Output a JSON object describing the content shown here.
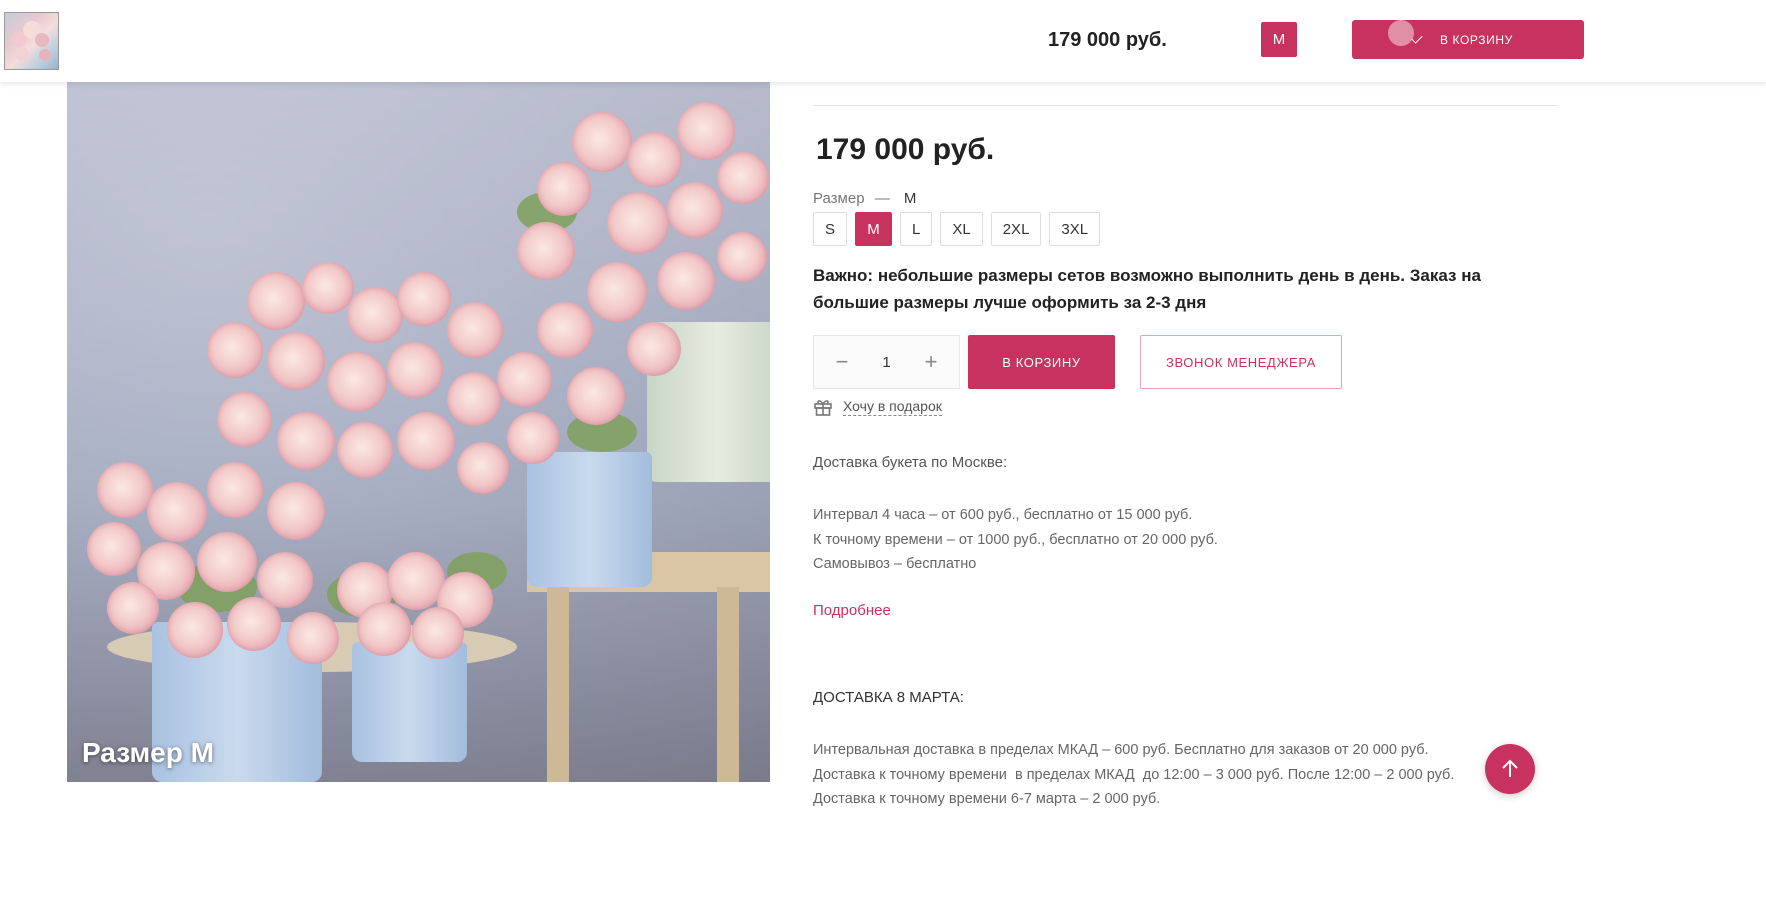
{
  "header": {
    "thumbnail_alt": "bouquet-thumbnail",
    "price": "179 000 руб.",
    "size": "M",
    "cart_label": "В КОРЗИНУ"
  },
  "product": {
    "photo_caption": "Размер M",
    "price": "179 000 руб.",
    "size_label": "Размер",
    "size_separator": "—",
    "selected_size": "M",
    "sizes": [
      "S",
      "M",
      "L",
      "XL",
      "2XL",
      "3XL"
    ],
    "notice": "Важно: небольшие размеры сетов возможно выполнить день в день. Заказ на большие размеры лучше оформить за 2-3 дня",
    "quantity": "1",
    "cart_button": "В КОРЗИНУ",
    "call_button": "ЗВОНОК МЕНЕДЖЕРА",
    "gift_link": "Хочу в подарок"
  },
  "delivery": {
    "title": "Доставка букета по Москве:",
    "lines": [
      "Интервал 4 часа – от 600 руб., бесплатно от 15 000 руб.",
      "К точному времени – от 1000 руб., бесплатно от 20 000 руб.",
      "Самовывоз – бесплатно"
    ],
    "more_link": "Подробнее"
  },
  "march_delivery": {
    "title": "ДОСТАВКА 8 МАРТА:",
    "lines": [
      "Интервальная доставка в пределах МКАД – 600 руб. Бесплатно для заказов от 20 000 руб.",
      "Доставка к точному времени  в пределах МКАД  до 12:00 – 3 000 руб. После 12:00 – 2 000 руб.",
      "Доставка к точному времени 6-7 марта – 2 000 руб."
    ]
  },
  "colors": {
    "accent": "#c8325f"
  },
  "icons": [
    "check-icon",
    "gift-icon",
    "arrow-up-icon",
    "minus-icon",
    "plus-icon"
  ]
}
